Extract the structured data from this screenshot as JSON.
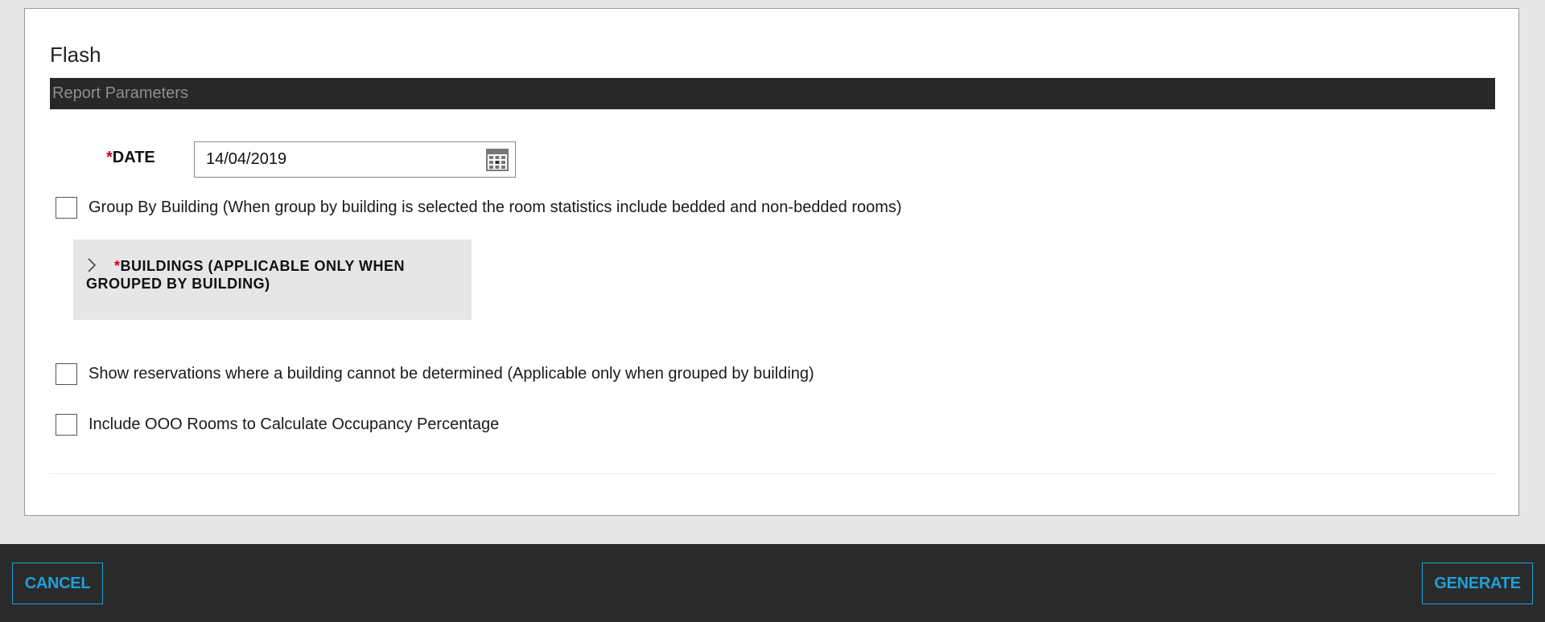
{
  "form": {
    "title": "Flash",
    "section_header": "Report Parameters",
    "date": {
      "required_mark": "*",
      "label": "DATE",
      "value": "14/04/2019",
      "icon": "calendar-icon"
    },
    "group_by_building": {
      "label": "Group By Building (When group by building is selected the room statistics include bedded and non-bedded rooms)",
      "checked": false
    },
    "buildings": {
      "required_mark": "*",
      "label": "BUILDINGS (APPLICABLE ONLY WHEN GROUPED BY BUILDING)",
      "icon": "chevron-right-icon"
    },
    "show_reservations": {
      "label": "Show reservations where a building cannot be determined (Applicable only when grouped by building)",
      "checked": false
    },
    "include_ooo": {
      "label": "Include OOO Rooms to Calculate Occupancy Percentage",
      "checked": false
    }
  },
  "footer": {
    "cancel_label": "CANCEL",
    "generate_label": "GENERATE",
    "accent_color": "#1ea0d8"
  }
}
